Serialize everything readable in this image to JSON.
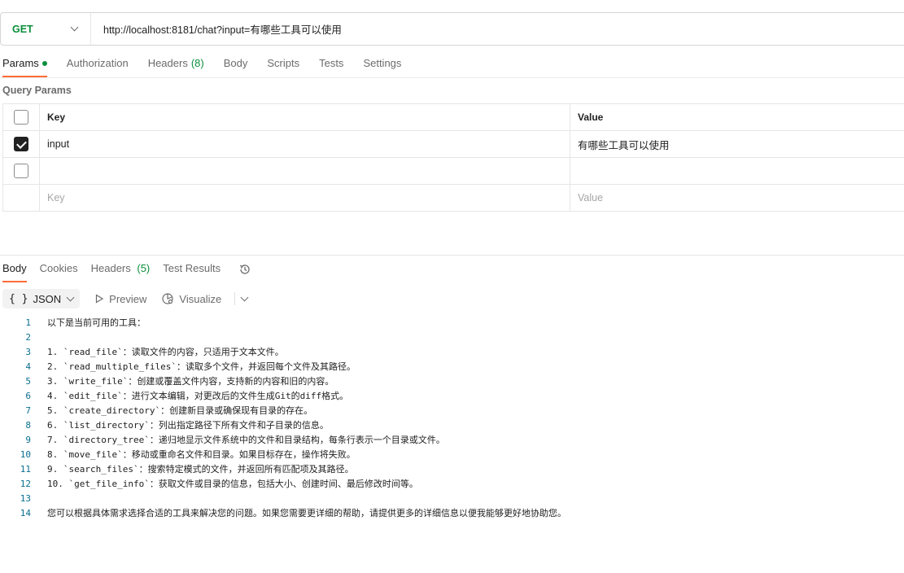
{
  "request": {
    "method": "GET",
    "url": "http://localhost:8181/chat?input=有哪些工具可以使用"
  },
  "request_tabs": [
    {
      "label": "Params",
      "active": true
    },
    {
      "label": "Authorization"
    },
    {
      "label": "Headers",
      "count": "(8)"
    },
    {
      "label": "Body"
    },
    {
      "label": "Scripts"
    },
    {
      "label": "Tests"
    },
    {
      "label": "Settings"
    }
  ],
  "query_params": {
    "title": "Query Params",
    "col_key": "Key",
    "col_value": "Value",
    "rows": [
      {
        "key": "input",
        "value": "有哪些工具可以使用",
        "checked": true
      }
    ],
    "placeholder_key": "Key",
    "placeholder_value": "Value"
  },
  "response_tabs": [
    {
      "label": "Body",
      "active": true
    },
    {
      "label": "Cookies"
    },
    {
      "label": "Headers",
      "count": "(5)"
    },
    {
      "label": "Test Results"
    }
  ],
  "format_bar": {
    "format_icon": "{ }",
    "format_label": "JSON",
    "preview_label": "Preview",
    "visualize_label": "Visualize"
  },
  "body_lines": [
    "以下是当前可用的工具：",
    "",
    "1. `read_file`：读取文件的内容，只适用于文本文件。",
    "2. `read_multiple_files`：读取多个文件，并返回每个文件及其路径。",
    "3. `write_file`：创建或覆盖文件内容，支持新的内容和旧的内容。",
    "4. `edit_file`：进行文本编辑，对更改后的文件生成Git的diff格式。",
    "5. `create_directory`：创建新目录或确保现有目录的存在。",
    "6. `list_directory`：列出指定路径下所有文件和子目录的信息。",
    "7. `directory_tree`：递归地显示文件系统中的文件和目录结构，每条行表示一个目录或文件。",
    "8. `move_file`：移动或重命名文件和目录。如果目标存在，操作将失败。",
    "9. `search_files`：搜索特定模式的文件，并返回所有匹配项及其路径。",
    "10. `get_file_info`：获取文件或目录的信息，包括大小、创建时间、最后修改时间等。",
    "",
    "您可以根据具体需求选择合适的工具来解决您的问题。如果您需要更详细的帮助，请提供更多的详细信息以便我能够更好地协助您。"
  ],
  "colors": {
    "method_get": "#0a8f3c",
    "active_tab_underline": "#ff6c37",
    "line_number": "#0a6e8f"
  }
}
